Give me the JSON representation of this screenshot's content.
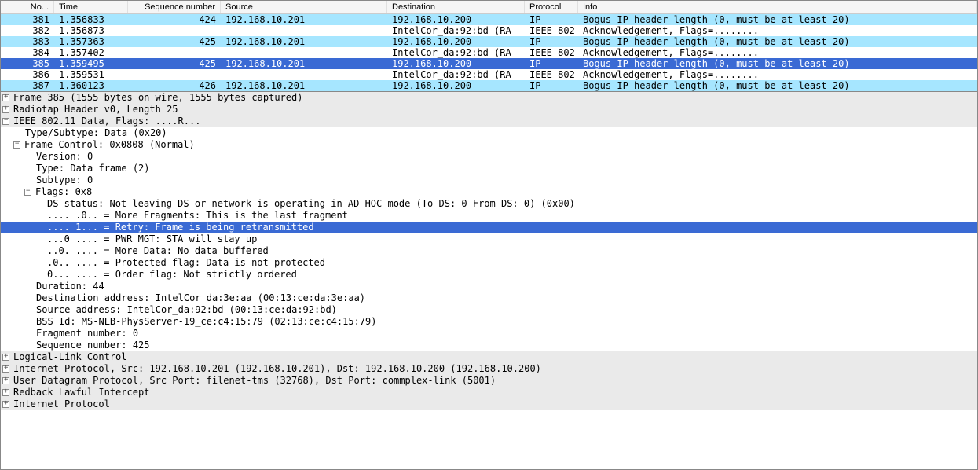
{
  "columns": {
    "no": "No. .",
    "time": "Time",
    "seq": "Sequence number",
    "src": "Source",
    "dst": "Destination",
    "prot": "Protocol",
    "info": "Info"
  },
  "rows": [
    {
      "no": "381",
      "time": "1.356833",
      "seq": "424",
      "src": "192.168.10.201",
      "dst": "192.168.10.200",
      "prot": "IP",
      "info": "Bogus IP header length (0, must be at least 20)",
      "cls": "hl-cyan"
    },
    {
      "no": "382",
      "time": "1.356873",
      "seq": "",
      "src": "",
      "dst": "IntelCor_da:92:bd (RA",
      "prot": "IEEE 802",
      "info": "Acknowledgement, Flags=........",
      "cls": ""
    },
    {
      "no": "383",
      "time": "1.357363",
      "seq": "425",
      "src": "192.168.10.201",
      "dst": "192.168.10.200",
      "prot": "IP",
      "info": "Bogus IP header length (0, must be at least 20)",
      "cls": "hl-cyan"
    },
    {
      "no": "384",
      "time": "1.357402",
      "seq": "",
      "src": "",
      "dst": "IntelCor_da:92:bd (RA",
      "prot": "IEEE 802",
      "info": "Acknowledgement, Flags=........",
      "cls": ""
    },
    {
      "no": "385",
      "time": "1.359495",
      "seq": "425",
      "src": "192.168.10.201",
      "dst": "192.168.10.200",
      "prot": "IP",
      "info": "Bogus IP header length (0, must be at least 20)",
      "cls": "hl-sel"
    },
    {
      "no": "386",
      "time": "1.359531",
      "seq": "",
      "src": "",
      "dst": "IntelCor_da:92:bd (RA",
      "prot": "IEEE 802",
      "info": "Acknowledgement, Flags=........",
      "cls": ""
    },
    {
      "no": "387",
      "time": "1.360123",
      "seq": "426",
      "src": "192.168.10.201",
      "dst": "192.168.10.200",
      "prot": "IP",
      "info": "Bogus IP header length (0, must be at least 20)",
      "cls": "hl-cyan"
    }
  ],
  "tree": [
    {
      "indent": 0,
      "ex": "plus",
      "cls": "top",
      "text": "Frame 385 (1555 bytes on wire, 1555 bytes captured)"
    },
    {
      "indent": 0,
      "ex": "plus",
      "cls": "top",
      "text": "Radiotap Header v0, Length 25"
    },
    {
      "indent": 0,
      "ex": "minus",
      "cls": "top",
      "text": "IEEE 802.11 Data, Flags: ....R..."
    },
    {
      "indent": 1,
      "ex": "",
      "cls": "",
      "text": "Type/Subtype: Data (0x20)"
    },
    {
      "indent": 1,
      "ex": "minus",
      "cls": "",
      "text": "Frame Control: 0x0808 (Normal)"
    },
    {
      "indent": 2,
      "ex": "",
      "cls": "",
      "text": "Version: 0"
    },
    {
      "indent": 2,
      "ex": "",
      "cls": "",
      "text": "Type: Data frame (2)"
    },
    {
      "indent": 2,
      "ex": "",
      "cls": "",
      "text": "Subtype: 0"
    },
    {
      "indent": 2,
      "ex": "minus",
      "cls": "",
      "text": "Flags: 0x8"
    },
    {
      "indent": 3,
      "ex": "",
      "cls": "",
      "text": "DS status: Not leaving DS or network is operating in AD-HOC mode (To DS: 0 From DS: 0) (0x00)"
    },
    {
      "indent": 3,
      "ex": "",
      "cls": "",
      "text": ".... .0.. = More Fragments: This is the last fragment"
    },
    {
      "indent": 3,
      "ex": "",
      "cls": "sel",
      "text": ".... 1... = Retry: Frame is being retransmitted"
    },
    {
      "indent": 3,
      "ex": "",
      "cls": "",
      "text": "...0 .... = PWR MGT: STA will stay up"
    },
    {
      "indent": 3,
      "ex": "",
      "cls": "",
      "text": "..0. .... = More Data: No data buffered"
    },
    {
      "indent": 3,
      "ex": "",
      "cls": "",
      "text": ".0.. .... = Protected flag: Data is not protected"
    },
    {
      "indent": 3,
      "ex": "",
      "cls": "",
      "text": "0... .... = Order flag: Not strictly ordered"
    },
    {
      "indent": 2,
      "ex": "",
      "cls": "",
      "text": "Duration: 44"
    },
    {
      "indent": 2,
      "ex": "",
      "cls": "",
      "text": "Destination address: IntelCor_da:3e:aa (00:13:ce:da:3e:aa)"
    },
    {
      "indent": 2,
      "ex": "",
      "cls": "",
      "text": "Source address: IntelCor_da:92:bd (00:13:ce:da:92:bd)"
    },
    {
      "indent": 2,
      "ex": "",
      "cls": "",
      "text": "BSS Id: MS-NLB-PhysServer-19_ce:c4:15:79 (02:13:ce:c4:15:79)"
    },
    {
      "indent": 2,
      "ex": "",
      "cls": "",
      "text": "Fragment number: 0"
    },
    {
      "indent": 2,
      "ex": "",
      "cls": "",
      "text": "Sequence number: 425"
    },
    {
      "indent": 0,
      "ex": "plus",
      "cls": "top",
      "text": "Logical-Link Control"
    },
    {
      "indent": 0,
      "ex": "plus",
      "cls": "top",
      "text": "Internet Protocol, Src: 192.168.10.201 (192.168.10.201), Dst: 192.168.10.200 (192.168.10.200)"
    },
    {
      "indent": 0,
      "ex": "plus",
      "cls": "top",
      "text": "User Datagram Protocol, Src Port: filenet-tms (32768), Dst Port: commplex-link (5001)"
    },
    {
      "indent": 0,
      "ex": "plus",
      "cls": "top",
      "text": "Redback Lawful Intercept"
    },
    {
      "indent": 0,
      "ex": "plus",
      "cls": "top",
      "text": "Internet Protocol"
    }
  ]
}
